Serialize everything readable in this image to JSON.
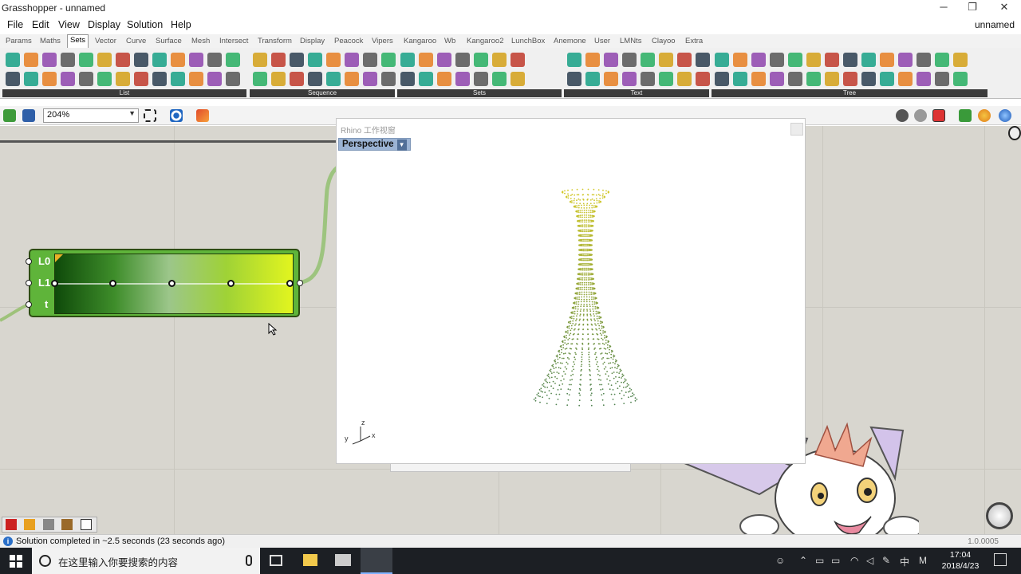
{
  "window": {
    "title": "Grasshopper - unnamed",
    "minimize": "─",
    "restore": "❐",
    "close": "✕"
  },
  "menu": {
    "items": [
      "File",
      "Edit",
      "View",
      "Display",
      "Solution",
      "Help"
    ],
    "doc_name": "unnamed"
  },
  "tabs": [
    "Params",
    "Maths",
    "Sets",
    "Vector",
    "Curve",
    "Surface",
    "Mesh",
    "Intersect",
    "Transform",
    "Display",
    "Peacock",
    "Vipers",
    "Kangaroo",
    "Wb",
    "Kangaroo2",
    "LunchBox",
    "Anemone",
    "User",
    "LMNts",
    "Clayoo",
    "Extra"
  ],
  "active_tab": "Sets",
  "ribbon_groups": [
    "List",
    "Sequence",
    "Sets",
    "Text",
    "Tree"
  ],
  "canvas_toolbar": {
    "zoom": "204%"
  },
  "component": {
    "inputs": [
      "L0",
      "L1",
      "t"
    ]
  },
  "rhino": {
    "title": "Rhino 工作视窗",
    "viewport": "Perspective",
    "axes": {
      "z": "z",
      "y": "y",
      "x": "x"
    }
  },
  "status": {
    "message": "Solution completed in ~2.5 seconds (23 seconds ago)",
    "version": "1.0.0005"
  },
  "taskbar": {
    "search_placeholder": "在这里输入你要搜索的内容",
    "ime": "中",
    "time": "17:04",
    "date": "2018/4/23"
  }
}
